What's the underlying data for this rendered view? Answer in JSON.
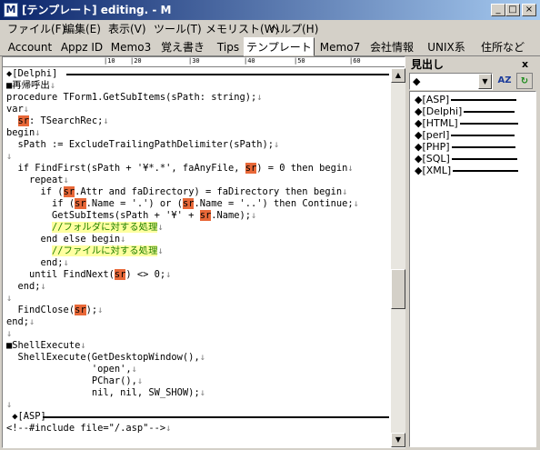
{
  "window": {
    "title": "[テンプレート] editing. - M",
    "icon_letter": "M",
    "buttons": {
      "minimize": "_",
      "maximize": "□",
      "close": "×"
    }
  },
  "menu": [
    "ファイル(F)",
    "編集(E)",
    "表示(V)",
    "ツール(T)",
    "メモリスト(W)",
    "ヘルプ(H)"
  ],
  "tabs": [
    "Account",
    "Appz ID",
    "Memo3",
    "覚え書き",
    "Tips",
    "テンプレート",
    "Memo7",
    "会社情報",
    "UNIX系",
    "住所など"
  ],
  "active_tab": "テンプレート",
  "ruler": {
    "marks": [
      "|10",
      "|20",
      "|30",
      "|40",
      "|50",
      "|60"
    ]
  },
  "editor": {
    "line_marker": "↓"
  },
  "side_panel": {
    "title": "見出し",
    "close": "x",
    "combo_value": "◆",
    "combo_arrow": "▼",
    "sort_button": "AZ",
    "refresh_button": "↻",
    "items": [
      "◆[ASP]",
      "◆[Delphi]",
      "◆[HTML]",
      "◆[perl]",
      "◆[PHP]",
      "◆[SQL]",
      "◆[XML]"
    ]
  },
  "colors": {
    "highlight": "#e86838",
    "comment_bg": "#ffffa0",
    "comment_fg": "#208000",
    "titlebar": "#0a246a"
  }
}
